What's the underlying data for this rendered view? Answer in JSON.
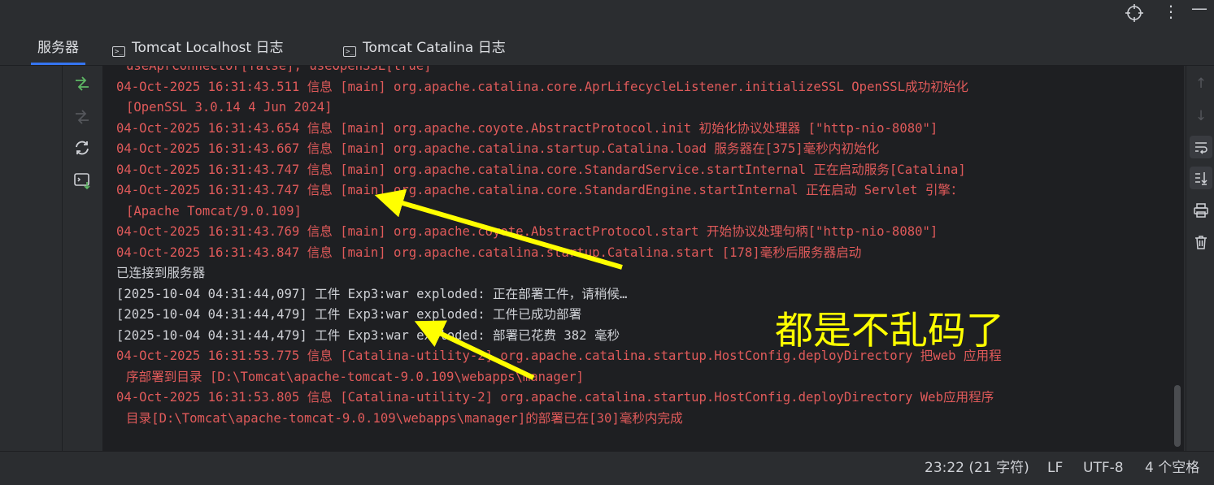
{
  "tabs": [
    {
      "label": "服务器",
      "active": true
    },
    {
      "label": "Tomcat Localhost 日志",
      "active": false
    },
    {
      "label": "Tomcat Catalina 日志",
      "active": false
    }
  ],
  "log_lines": [
    {
      "text": "useAprConnector[false], useOpenSSL[true]",
      "kind": "err",
      "cont": true
    },
    {
      "text": "04-Oct-2025 16:31:43.511 信息 [main] org.apache.catalina.core.AprLifecycleListener.initializeSSL OpenSSL成功初始化",
      "kind": "err",
      "cont": false
    },
    {
      "text": "[OpenSSL 3.0.14 4 Jun 2024]",
      "kind": "err",
      "cont": true
    },
    {
      "text": "04-Oct-2025 16:31:43.654 信息 [main] org.apache.coyote.AbstractProtocol.init 初始化协议处理器 [\"http-nio-8080\"]",
      "kind": "err",
      "cont": false
    },
    {
      "text": "04-Oct-2025 16:31:43.667 信息 [main] org.apache.catalina.startup.Catalina.load 服务器在[375]毫秒内初始化",
      "kind": "err",
      "cont": false
    },
    {
      "text": "04-Oct-2025 16:31:43.747 信息 [main] org.apache.catalina.core.StandardService.startInternal 正在启动服务[Catalina]",
      "kind": "err",
      "cont": false
    },
    {
      "text": "04-Oct-2025 16:31:43.747 信息 [main] org.apache.catalina.core.StandardEngine.startInternal 正在启动 Servlet 引擎：",
      "kind": "err",
      "cont": false
    },
    {
      "text": "[Apache Tomcat/9.0.109]",
      "kind": "err",
      "cont": true
    },
    {
      "text": "04-Oct-2025 16:31:43.769 信息 [main] org.apache.coyote.AbstractProtocol.start 开始协议处理句柄[\"http-nio-8080\"]",
      "kind": "err",
      "cont": false
    },
    {
      "text": "04-Oct-2025 16:31:43.847 信息 [main] org.apache.catalina.startup.Catalina.start [178]毫秒后服务器启动",
      "kind": "err",
      "cont": false
    },
    {
      "text": "已连接到服务器",
      "kind": "info",
      "cont": false
    },
    {
      "text": "[2025-10-04 04:31:44,097] 工件 Exp3:war exploded: 正在部署工件，请稍候…",
      "kind": "info",
      "cont": false
    },
    {
      "text": "[2025-10-04 04:31:44,479] 工件 Exp3:war exploded: 工件已成功部署",
      "kind": "info",
      "cont": false
    },
    {
      "text": "[2025-10-04 04:31:44,479] 工件 Exp3:war exploded: 部署已花费 382 毫秒",
      "kind": "info",
      "cont": false
    },
    {
      "text": "04-Oct-2025 16:31:53.775 信息 [Catalina-utility-2] org.apache.catalina.startup.HostConfig.deployDirectory 把web 应用程",
      "kind": "err",
      "cont": false
    },
    {
      "text": "序部署到目录 [D:\\Tomcat\\apache-tomcat-9.0.109\\webapps\\manager]",
      "kind": "err",
      "cont": true
    },
    {
      "text": "04-Oct-2025 16:31:53.805 信息 [Catalina-utility-2] org.apache.catalina.startup.HostConfig.deployDirectory Web应用程序",
      "kind": "err",
      "cont": false
    },
    {
      "text": "目录[D:\\Tomcat\\apache-tomcat-9.0.109\\webapps\\manager]的部署已在[30]毫秒内完成",
      "kind": "err",
      "cont": true
    }
  ],
  "status_bar": {
    "position": "23:22 (21 字符)",
    "line_ending": "LF",
    "encoding": "UTF-8",
    "indent": "4 个空格"
  },
  "annotation": {
    "text": "都是不乱码了",
    "color": "#ffff00"
  },
  "colors": {
    "log_error": "#e05a5a",
    "log_info": "#cfd1d6",
    "accent": "#3574f0",
    "console_bg": "#1e1f22"
  },
  "icons": {
    "top": [
      "crosshair-icon",
      "more-vertical-icon",
      "minimize-icon"
    ],
    "left_actions": [
      "deploy-arrows-icon",
      "redeploy-disabled-icon",
      "refresh-icon",
      "terminal-download-icon"
    ],
    "right_actions": [
      "scroll-up-icon",
      "scroll-down-icon",
      "soft-wrap-icon",
      "scroll-to-end-icon",
      "print-icon",
      "trash-icon"
    ]
  }
}
